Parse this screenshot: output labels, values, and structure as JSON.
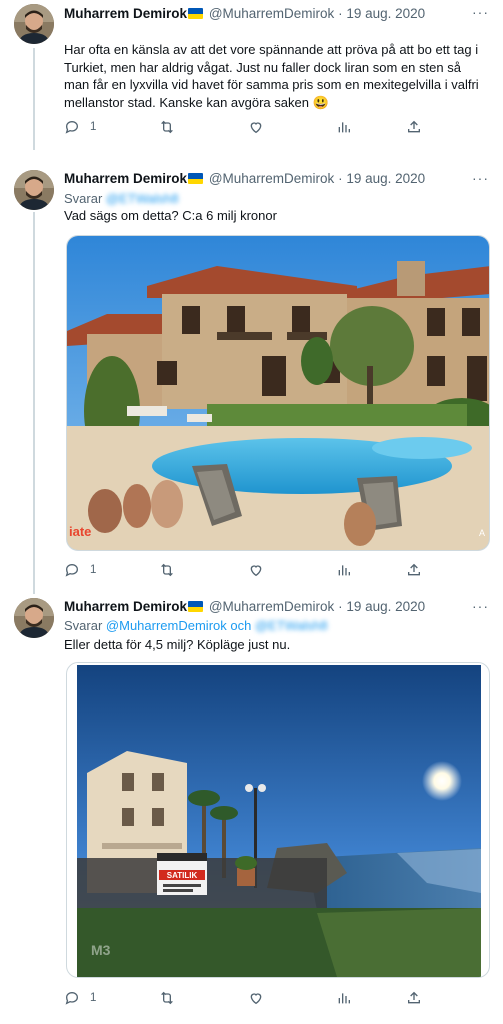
{
  "tweets": [
    {
      "author_name": "Muharrem Demirok",
      "handle": "@MuharremDemirok",
      "dot": "·",
      "date": "19 aug. 2020",
      "more_label": "···",
      "text": "Har ofta en känsla av att det vore spännande att pröva på att bo ett tag i Turkiet, men har aldrig vågat. Just nu faller dock liran som en sten så man får en lyxvilla vid havet för samma pris som en mexitegelvilla i valfri mellanstor stad. Kanske kan avgöra saken 😃",
      "reply_count": "1"
    },
    {
      "author_name": "Muharrem Demirok",
      "handle": "@MuharremDemirok",
      "dot": "·",
      "date": "19 aug. 2020",
      "more_label": "···",
      "reply_prefix": "Svarar",
      "reply_target": "@ETWalsh8",
      "text": "Vad sägs om detta? C:a 6 milj kronor",
      "reply_count": "1"
    },
    {
      "author_name": "Muharrem Demirok",
      "handle": "@MuharremDemirok",
      "dot": "·",
      "date": "19 aug. 2020",
      "more_label": "···",
      "reply_prefix": "Svarar",
      "reply_target_1": "@MuharremDemirok",
      "reply_and": "och",
      "reply_target_2": "@ETWalsh8",
      "text": "Eller detta för 4,5 milj? Köpläge just nu.",
      "reply_count": "1"
    }
  ],
  "media": {
    "villa_watermark": "iate",
    "villa_corner": "A",
    "apartment_sign": "SATILIK",
    "apartment_watermark": "M3"
  },
  "colors": {
    "accent": "#1d9bf0",
    "secondary_text": "#536471",
    "flag_blue": "#0057b7",
    "flag_yellow": "#ffd700"
  }
}
